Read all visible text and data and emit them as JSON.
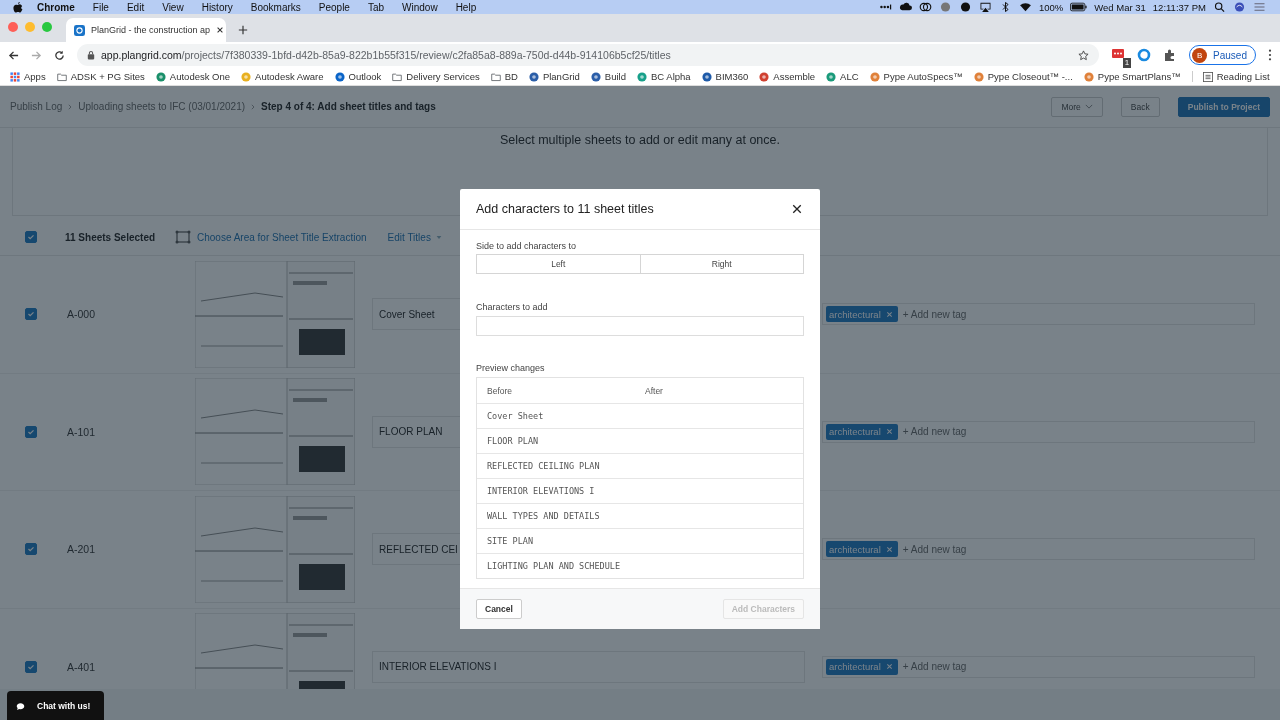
{
  "menubar": {
    "app": "Chrome",
    "menus": [
      "File",
      "Edit",
      "View",
      "History",
      "Bookmarks",
      "People",
      "Tab",
      "Window",
      "Help"
    ],
    "battery": "100%",
    "date": "Wed Mar 31",
    "time": "12:11:37 PM"
  },
  "browser": {
    "tab_title": "PlanGrid - the construction ap",
    "url_host": "app.plangrid.com",
    "url_path": "/projects/7f380339-1bfd-d42b-85a9-822b1b55f315/review/c2fa85a8-889a-750d-d44b-914106b5cf25/titles",
    "extension_badge": "1",
    "profile_initial": "B",
    "profile_status": "Paused"
  },
  "bookmarks": [
    {
      "label": "Apps",
      "kind": "apps"
    },
    {
      "label": "ADSK + PG Sites",
      "kind": "folder"
    },
    {
      "label": "Autodesk One",
      "kind": "site",
      "color": "#1a8f6a"
    },
    {
      "label": "Autodesk Aware",
      "kind": "site",
      "color": "#e8b020"
    },
    {
      "label": "Outlook",
      "kind": "site",
      "color": "#0a64c8"
    },
    {
      "label": "Delivery Services",
      "kind": "folder"
    },
    {
      "label": "BD",
      "kind": "folder"
    },
    {
      "label": "PlanGrid",
      "kind": "site",
      "color": "#2b5ea8"
    },
    {
      "label": "Build",
      "kind": "site",
      "color": "#2b5ea8"
    },
    {
      "label": "BC Alpha",
      "kind": "site",
      "color": "#18a08a"
    },
    {
      "label": "BIM360",
      "kind": "site",
      "color": "#1e5aa8"
    },
    {
      "label": "Assemble",
      "kind": "site",
      "color": "#d04030"
    },
    {
      "label": "ALC",
      "kind": "site",
      "color": "#1a9a7a"
    },
    {
      "label": "Pype AutoSpecs™",
      "kind": "site",
      "color": "#e0813a"
    },
    {
      "label": "Pype Closeout™ -...",
      "kind": "site",
      "color": "#e0813a"
    },
    {
      "label": "Pype SmartPlans™",
      "kind": "site",
      "color": "#e0813a"
    }
  ],
  "reading_list": "Reading List",
  "breadcrumb": [
    {
      "label": "Publish Log",
      "current": false
    },
    {
      "label": "Uploading sheets to IFC (03/01/2021)",
      "current": false
    },
    {
      "label": "Step 4 of 4: Add sheet titles and tags",
      "current": true
    }
  ],
  "header_buttons": [
    {
      "label": "More",
      "kind": "menu"
    },
    {
      "label": "Back",
      "kind": "plain"
    },
    {
      "label": "Publish to Project",
      "kind": "primary"
    }
  ],
  "banner": "Select multiple sheets to add or edit many at once.",
  "toolbar": {
    "checked": true,
    "selected_count": "11 Sheets Selected",
    "area_action": "Choose Area for Sheet Title Extraction",
    "edit_menu": "Edit Titles"
  },
  "sheets": [
    {
      "number": "A-000",
      "title": "Cover Sheet",
      "checked": true,
      "tags": [
        "architectural"
      ],
      "tag_placeholder": "+ Add new tag"
    },
    {
      "number": "A-101",
      "title": "FLOOR PLAN",
      "checked": true,
      "tags": [
        "architectural"
      ],
      "tag_placeholder": "+ Add new tag"
    },
    {
      "number": "A-201",
      "title": "REFLECTED CEI",
      "checked": true,
      "tags": [
        "architectural"
      ],
      "tag_placeholder": "+ Add new tag"
    },
    {
      "number": "A-401",
      "title": "INTERIOR ELEVATIONS I",
      "checked": true,
      "tags": [
        "architectural"
      ],
      "tag_placeholder": "+ Add new tag"
    }
  ],
  "modal": {
    "title": "Add characters to 11 sheet titles",
    "side_label": "Side to add characters to",
    "sides": [
      "Left",
      "Right"
    ],
    "chars_label": "Characters to add",
    "preview_label": "Preview changes",
    "columns": [
      "Before",
      "After"
    ],
    "rows": [
      "Cover Sheet",
      "FLOOR PLAN",
      "REFLECTED CEILING PLAN",
      "INTERIOR ELEVATIONS I",
      "WALL TYPES AND DETAILS",
      "SITE PLAN",
      "LIGHTING PLAN AND SCHEDULE"
    ],
    "cancel": "Cancel",
    "submit": {
      "label": "Add Characters",
      "disabled": true
    }
  },
  "chat": "Chat with us!"
}
